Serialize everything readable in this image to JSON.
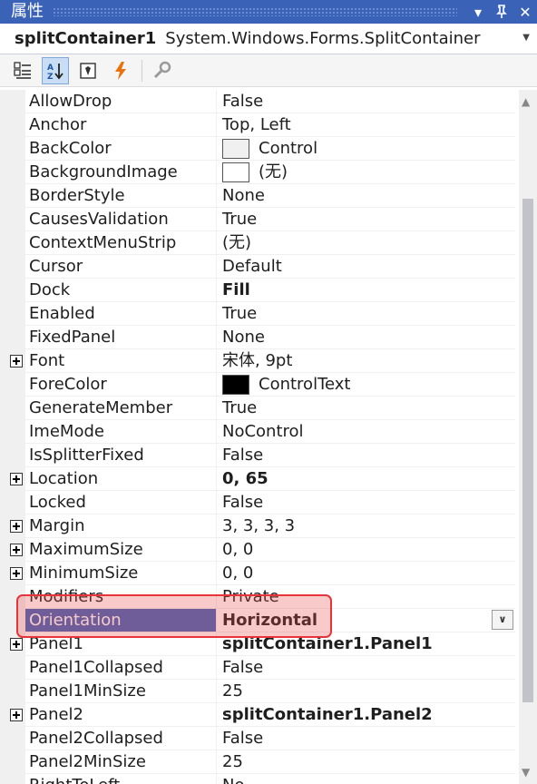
{
  "window": {
    "title": "属性",
    "dropdown_icon": "chevron-down-icon",
    "pin_icon": "pin-icon",
    "close_icon": "close-icon"
  },
  "object_selector": {
    "name": "splitContainer1",
    "type": "System.Windows.Forms.SplitContainer"
  },
  "toolbar": {
    "buttons": [
      {
        "name": "categorized-icon",
        "active": false
      },
      {
        "name": "alphabetical-icon",
        "active": true
      },
      {
        "name": "properties-icon",
        "active": false
      },
      {
        "name": "events-icon",
        "active": false
      },
      {
        "name": "property-pages-icon",
        "active": false
      }
    ]
  },
  "properties": [
    {
      "name": "AllowDrop",
      "value": "False"
    },
    {
      "name": "Anchor",
      "value": "Top, Left"
    },
    {
      "name": "BackColor",
      "value": "Control",
      "swatch": "#f0f0f0"
    },
    {
      "name": "BackgroundImage",
      "value": "(无)",
      "swatch": "#ffffff"
    },
    {
      "name": "BorderStyle",
      "value": "None"
    },
    {
      "name": "CausesValidation",
      "value": "True"
    },
    {
      "name": "ContextMenuStrip",
      "value": "(无)"
    },
    {
      "name": "Cursor",
      "value": "Default"
    },
    {
      "name": "Dock",
      "value": "Fill",
      "bold": true
    },
    {
      "name": "Enabled",
      "value": "True"
    },
    {
      "name": "FixedPanel",
      "value": "None"
    },
    {
      "name": "Font",
      "value": "宋体, 9pt",
      "expandable": true
    },
    {
      "name": "ForeColor",
      "value": "ControlText",
      "swatch": "#000000"
    },
    {
      "name": "GenerateMember",
      "value": "True"
    },
    {
      "name": "ImeMode",
      "value": "NoControl"
    },
    {
      "name": "IsSplitterFixed",
      "value": "False"
    },
    {
      "name": "Location",
      "value": "0, 65",
      "bold": true,
      "expandable": true
    },
    {
      "name": "Locked",
      "value": "False"
    },
    {
      "name": "Margin",
      "value": "3, 3, 3, 3",
      "expandable": true
    },
    {
      "name": "MaximumSize",
      "value": "0, 0",
      "expandable": true
    },
    {
      "name": "MinimumSize",
      "value": "0, 0",
      "expandable": true
    },
    {
      "name": "Modifiers",
      "value": "Private"
    },
    {
      "name": "Orientation",
      "value": "Horizontal",
      "bold": true,
      "selected": true
    },
    {
      "name": "Panel1",
      "value": "splitContainer1.Panel1",
      "bold": true,
      "expandable": true
    },
    {
      "name": "Panel1Collapsed",
      "value": "False"
    },
    {
      "name": "Panel1MinSize",
      "value": "25"
    },
    {
      "name": "Panel2",
      "value": "splitContainer1.Panel2",
      "bold": true,
      "expandable": true
    },
    {
      "name": "Panel2Collapsed",
      "value": "False"
    },
    {
      "name": "Panel2MinSize",
      "value": "25"
    },
    {
      "name": "RightToLeft",
      "value": "No"
    }
  ],
  "colors": {
    "title_bar": "#3a63b8",
    "selection": "#3a63b8",
    "highlight_border": "#e5353a"
  }
}
